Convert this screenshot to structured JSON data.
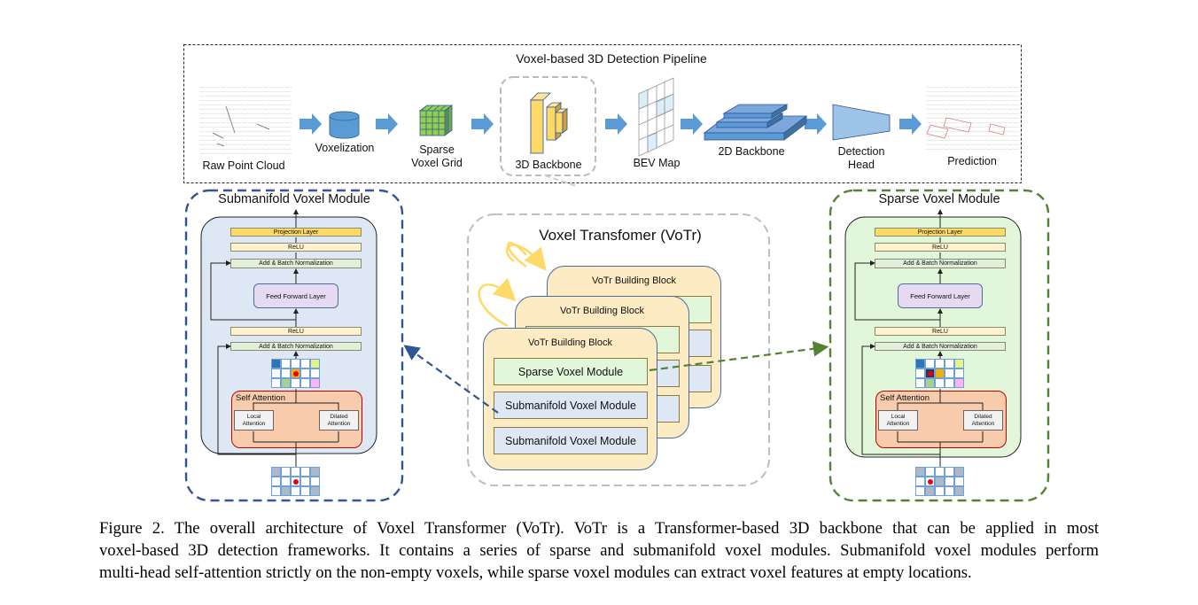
{
  "pipeline": {
    "title": "Voxel-based 3D Detection Pipeline",
    "stages": {
      "raw_point_cloud": "Raw Point Cloud",
      "voxelization": "Voxelization",
      "sparse_voxel_grid_1": "Sparse",
      "sparse_voxel_grid_2": "Voxel Grid",
      "backbone_3d": "3D Backbone",
      "bev_map": "BEV Map",
      "backbone_2d": "2D Backbone",
      "detection_head_1": "Detection",
      "detection_head_2": "Head",
      "prediction": "Prediction"
    }
  },
  "votr": {
    "title": "Voxel Transfomer (VoTr)",
    "block_title": "VoTr Building Block",
    "modules": [
      "Sparse Voxel Module",
      "Submanifold Voxel Module",
      "Submanifold Voxel Module"
    ]
  },
  "submanifold_module": {
    "title": "Submanifold Voxel Module",
    "projection": "Projection Layer",
    "relu": "ReLU",
    "add_bn": "Add & Batch Normalization",
    "ffn": "Feed Forward Layer",
    "self_attention": "Self Attention",
    "local_attention_1": "Local",
    "local_attention_2": "Attention",
    "dilated_attention_1": "Dilated",
    "dilated_attention_2": "Attention"
  },
  "sparse_module": {
    "title": "Sparse Voxel Module",
    "projection": "Projection Layer",
    "relu": "ReLU",
    "add_bn": "Add & Batch Normalization",
    "ffn": "Feed Forward Layer",
    "self_attention": "Self Attention",
    "local_attention_1": "Local",
    "local_attention_2": "Attention",
    "dilated_attention_1": "Dilated",
    "dilated_attention_2": "Attention"
  },
  "caption": {
    "lines": [
      "Figure 2. The overall architecture of Voxel Transformer (VoTr).  VoTr is a Transformer-based 3D backbone that can be applied in most",
      "voxel-based 3D detection frameworks. It contains a series of sparse and submanifold voxel modules. Submanifold voxel modules perform",
      "multi-head self-attention strictly on the non-empty voxels, while sparse voxel modules can extract voxel features at empty locations."
    ]
  },
  "colors": {
    "arrow_blue": "#5b9bd5",
    "submanifold_border": "#2f5597",
    "submanifold_fill": "#dde8f4",
    "sparse_border": "#548235",
    "sparse_fill": "#e2f7d9",
    "block_fill": "#fdebc3",
    "self_attention_fill": "#f8cbad",
    "ffn_fill": "#e6d9f2"
  }
}
